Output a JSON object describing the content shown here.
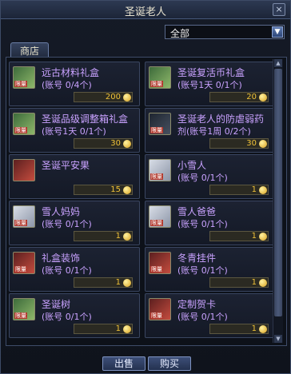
{
  "window": {
    "title": "圣诞老人",
    "close_glyph": "×"
  },
  "filter": {
    "selected": "全部",
    "arrow_glyph": "▼"
  },
  "tabs": [
    {
      "label": "商店"
    }
  ],
  "items": [
    {
      "name": "远古材料礼盒",
      "sub": "(账号 0/4个)",
      "price": "200",
      "icon": "gift-box-icon",
      "badge": "限量"
    },
    {
      "name": "圣诞复活币礼盒",
      "sub": "(账号1天 0/1个)",
      "price": "20",
      "icon": "gift-box-icon",
      "badge": "限量"
    },
    {
      "name": "圣诞品级调整箱礼盒",
      "sub": "(账号1天 0/1个)",
      "price": "30",
      "icon": "gift-box-icon",
      "badge": "限量"
    },
    {
      "name": "圣诞老人的防虐弱药",
      "sub": "剂(账号1周 0/2个)",
      "price": "30",
      "icon": "potion-icon",
      "badge": "限量"
    },
    {
      "name": "圣诞平安果",
      "sub": "",
      "price": "15",
      "icon": "apple-icon",
      "badge": ""
    },
    {
      "name": "小雪人",
      "sub": "(账号 0/1个)",
      "price": "1",
      "icon": "snowman-icon",
      "badge": "限量"
    },
    {
      "name": "雪人妈妈",
      "sub": "(账号 0/1个)",
      "price": "1",
      "icon": "snowman-icon",
      "badge": "限量"
    },
    {
      "name": "雪人爸爸",
      "sub": "(账号 0/1个)",
      "price": "1",
      "icon": "snowman-icon",
      "badge": "限量"
    },
    {
      "name": "礼盒装饰",
      "sub": "(账号 0/1个)",
      "price": "1",
      "icon": "gift-decor-icon",
      "badge": "限量"
    },
    {
      "name": "冬青挂件",
      "sub": "(账号 0/1个)",
      "price": "1",
      "icon": "holly-icon",
      "badge": "限量"
    },
    {
      "name": "圣诞树",
      "sub": "(账号 0/1个)",
      "price": "1",
      "icon": "tree-icon",
      "badge": "限量"
    },
    {
      "name": "定制贺卡",
      "sub": "(账号 0/1个)",
      "price": "1",
      "icon": "card-icon",
      "badge": "限量"
    }
  ],
  "buttons": {
    "sell": "出售",
    "buy": "购买"
  },
  "scrollbar": {
    "up_glyph": "▲",
    "down_glyph": "▼"
  }
}
